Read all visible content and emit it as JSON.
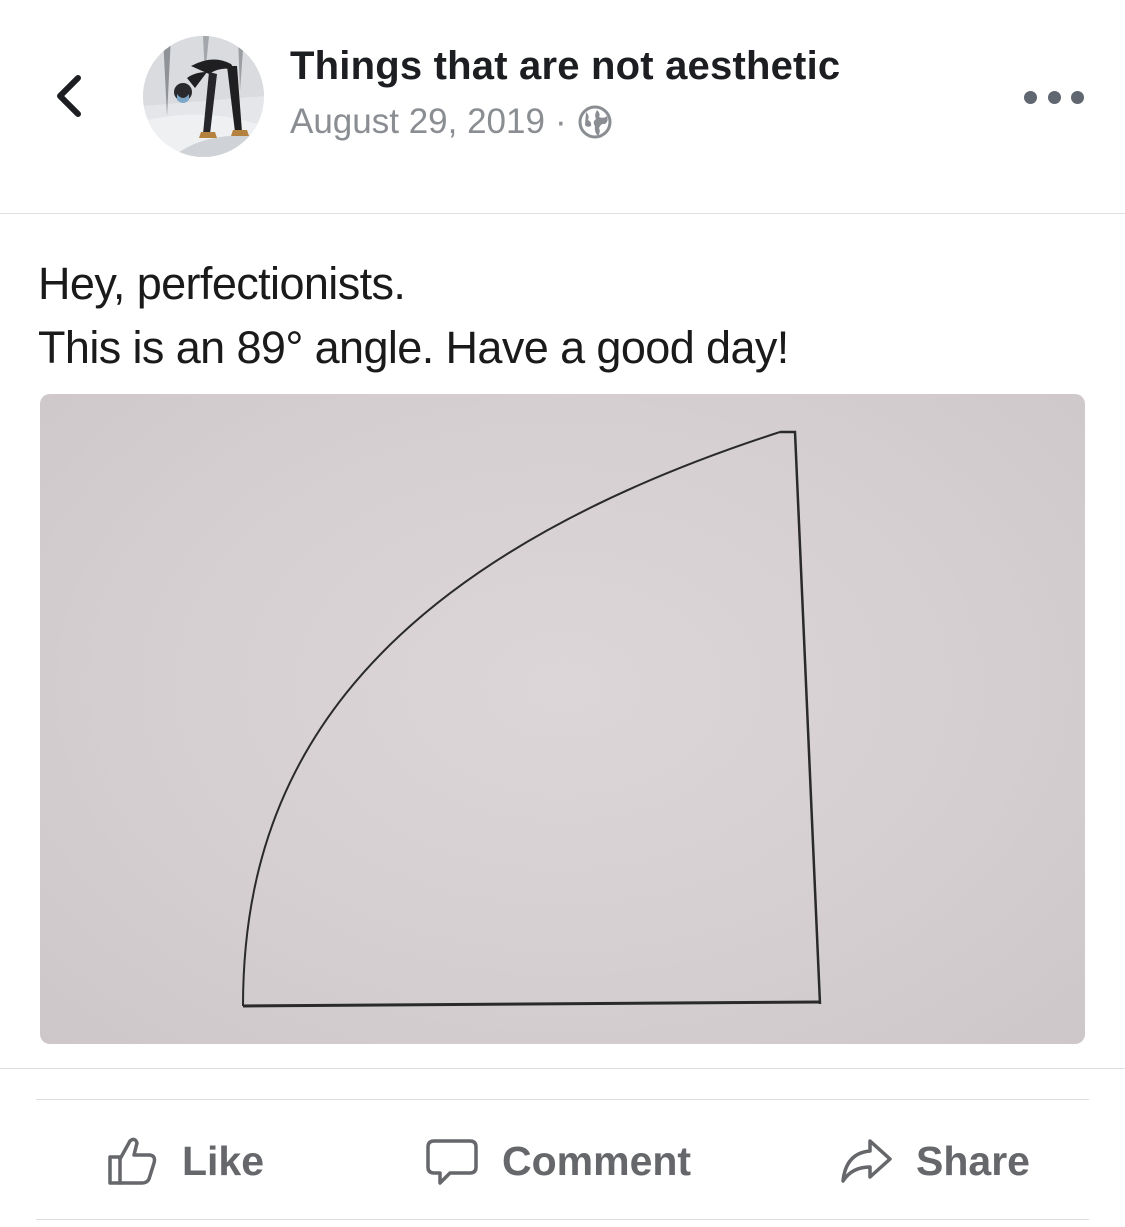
{
  "post": {
    "page_name": "Things that are not aesthetic",
    "date": "August 29, 2019",
    "separator": "·",
    "privacy_icon": "globe-icon",
    "back_icon": "chevron-left-icon",
    "more_icon": "more-horizontal-icon"
  },
  "image": {
    "caption_line1": "Hey, perfectionists.",
    "caption_line2": "This is an 89° angle. Have a good day!"
  },
  "actions": {
    "like_label": "Like",
    "comment_label": "Comment",
    "share_label": "Share",
    "like_icon": "thumbs-up-icon",
    "comment_icon": "speech-bubble-icon",
    "share_icon": "share-arrow-icon"
  },
  "colors": {
    "text_primary": "#1c1e21",
    "text_secondary": "#8a8d91",
    "action_gray": "#65676b",
    "divider": "#dadde1"
  }
}
